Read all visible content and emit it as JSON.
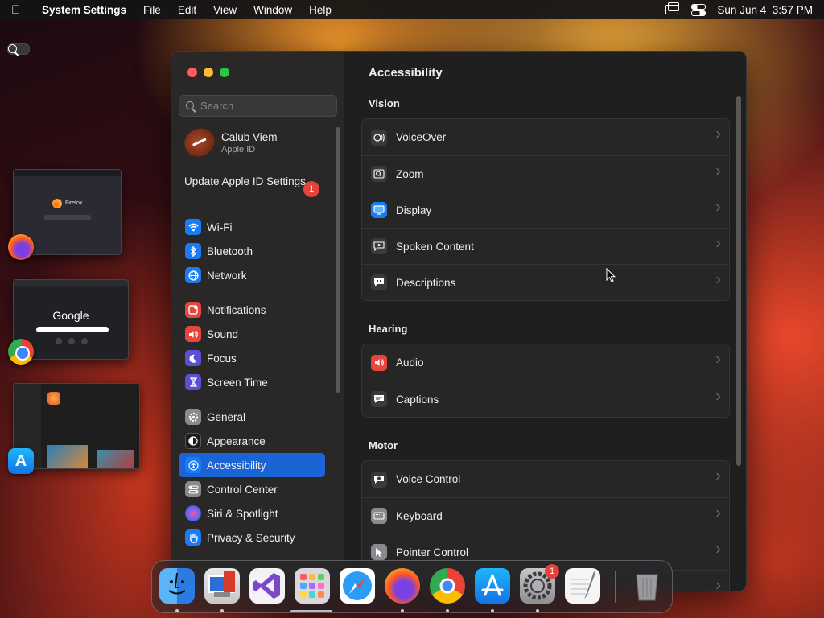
{
  "menubar": {
    "app_name": "System Settings",
    "menus": [
      "File",
      "Edit",
      "View",
      "Window",
      "Help"
    ],
    "clock": "Sun Jun 4  3:57 PM"
  },
  "stage_manager": {
    "firefox_title": "Firefox",
    "chrome_title": "Google"
  },
  "window": {
    "search_placeholder": "Search",
    "profile": {
      "name": "Calub Viem",
      "subtitle": "Apple ID"
    },
    "update": {
      "label": "Update Apple ID Settings",
      "badge": "1"
    },
    "sidebar_groups": [
      [
        {
          "label": "Wi-Fi",
          "icon": "wifi-icon",
          "color": "#1a7cf5"
        },
        {
          "label": "Bluetooth",
          "icon": "bluetooth-icon",
          "color": "#1a7cf5"
        },
        {
          "label": "Network",
          "icon": "globe-icon",
          "color": "#1a7cf5"
        }
      ],
      [
        {
          "label": "Notifications",
          "icon": "bell-icon",
          "color": "#e8453c"
        },
        {
          "label": "Sound",
          "icon": "speaker-icon",
          "color": "#e8453c"
        },
        {
          "label": "Focus",
          "icon": "moon-icon",
          "color": "#5b4fd6"
        },
        {
          "label": "Screen Time",
          "icon": "hourglass-icon",
          "color": "#5b4fd6"
        }
      ],
      [
        {
          "label": "General",
          "icon": "gear-icon",
          "color": "#8a8a8e"
        },
        {
          "label": "Appearance",
          "icon": "appearance-icon",
          "color": "#1c1c1e"
        },
        {
          "label": "Accessibility",
          "icon": "accessibility-icon",
          "color": "#1a7cf5",
          "active": true
        },
        {
          "label": "Control Center",
          "icon": "control-center-icon",
          "color": "#8a8a8e"
        },
        {
          "label": "Siri & Spotlight",
          "icon": "siri-icon",
          "color": "#b03ad6"
        },
        {
          "label": "Privacy & Security",
          "icon": "hand-icon",
          "color": "#1a7cf5"
        }
      ]
    ],
    "main": {
      "title": "Accessibility",
      "sections": [
        {
          "title": "Vision",
          "rows": [
            {
              "label": "VoiceOver",
              "icon": "voiceover-icon",
              "color": "#3a3a3c"
            },
            {
              "label": "Zoom",
              "icon": "zoom-icon",
              "color": "#3a3a3c"
            },
            {
              "label": "Display",
              "icon": "display-icon",
              "color": "#1a7cf5"
            },
            {
              "label": "Spoken Content",
              "icon": "spoken-content-icon",
              "color": "#3a3a3c"
            },
            {
              "label": "Descriptions",
              "icon": "descriptions-icon",
              "color": "#3a3a3c"
            }
          ]
        },
        {
          "title": "Hearing",
          "rows": [
            {
              "label": "Audio",
              "icon": "audio-icon",
              "color": "#e8453c"
            },
            {
              "label": "Captions",
              "icon": "captions-icon",
              "color": "#3a3a3c"
            }
          ]
        },
        {
          "title": "Motor",
          "rows": [
            {
              "label": "Voice Control",
              "icon": "voice-control-icon",
              "color": "#3a3a3c"
            },
            {
              "label": "Keyboard",
              "icon": "keyboard-icon",
              "color": "#8a8a8e"
            },
            {
              "label": "Pointer Control",
              "icon": "pointer-icon",
              "color": "#8a8a8e"
            },
            {
              "label": "",
              "icon": "switch-icon",
              "color": "#3a3a3c"
            }
          ]
        }
      ]
    }
  },
  "dock": {
    "apps": [
      {
        "name": "finder-icon",
        "running": true
      },
      {
        "name": "remote-desktop-icon",
        "running": true
      },
      {
        "name": "visual-studio-icon",
        "running": false
      },
      {
        "name": "launchpad-icon",
        "running": false
      },
      {
        "name": "safari-icon",
        "running": false
      },
      {
        "name": "firefox-icon",
        "running": true
      },
      {
        "name": "chrome-icon",
        "running": true
      },
      {
        "name": "app-store-icon",
        "running": true
      },
      {
        "name": "system-settings-icon",
        "running": true,
        "badge": "1"
      },
      {
        "name": "textedit-icon",
        "running": false
      },
      {
        "name": "trash-icon",
        "running": false
      }
    ]
  }
}
